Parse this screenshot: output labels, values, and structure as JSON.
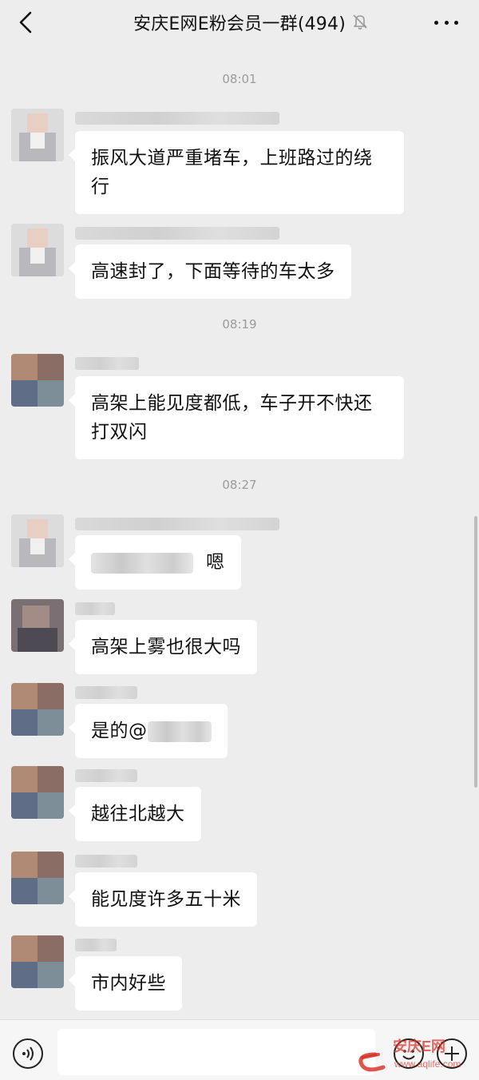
{
  "header": {
    "title": "安庆E网E粉会员一群(494)",
    "back_icon": "chevron-left-icon",
    "mute_icon": "bell-off-icon",
    "more_icon": "more-horizontal-icon"
  },
  "timestamps": [
    "08:01",
    "08:19",
    "08:27"
  ],
  "messages": [
    {
      "text": "振风大道严重堵车，上班路过的绕行"
    },
    {
      "text": "高速封了，下面等待的车太多"
    },
    {
      "text": "高架上能见度都低，车子开不快还打双闪"
    },
    {
      "text": "嗯"
    },
    {
      "text": "高架上雾也很大吗"
    },
    {
      "text": "是的@"
    },
    {
      "text": "越往北越大"
    },
    {
      "text": "能见度许多五十米"
    },
    {
      "text": "市内好些"
    }
  ],
  "bottom_bar": {
    "voice_icon": "voice-icon",
    "emoji_icon": "emoji-icon",
    "plus_icon": "plus-icon"
  },
  "watermark": {
    "brand": "安庆E网",
    "url": "www.aqlife.com"
  },
  "colors": {
    "background": "#ededed",
    "bubble": "#ffffff",
    "timestamp": "#9b9b9b",
    "watermark_red": "#d9362b"
  }
}
